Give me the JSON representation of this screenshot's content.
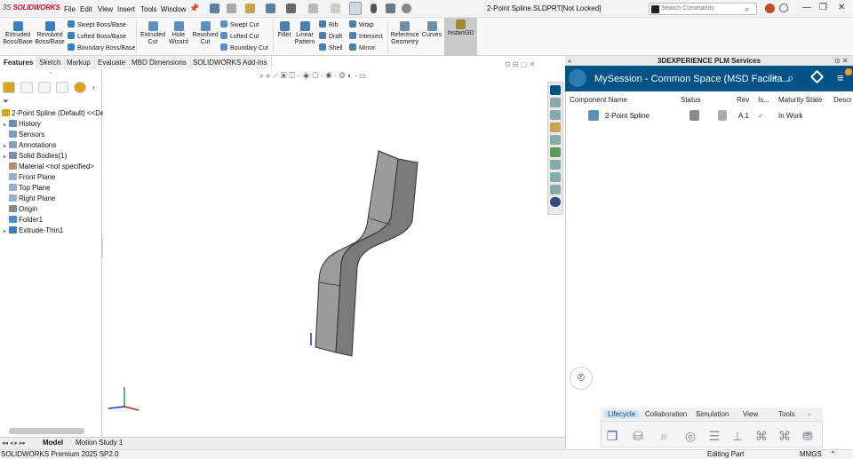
{
  "app": {
    "logo_a": "3S",
    "logo_b": "SOLIDWORKS",
    "title": "2-Point Spline.SLDPRT[Not Locked]",
    "search_placeholder": "Search Commands"
  },
  "menu": [
    "File",
    "Edit",
    "View",
    "Insert",
    "Tools",
    "Window"
  ],
  "ribbon": {
    "big": [
      {
        "l1": "Extruded",
        "l2": "Boss/Base",
        "c": "#3a7fc1"
      },
      {
        "l1": "Revolved",
        "l2": "Boss/Base",
        "c": "#3a7fc1"
      }
    ],
    "small1": [
      "Swept Boss/Base",
      "Lofted Boss/Base",
      "Boundary Boss/Base"
    ],
    "big2": [
      {
        "l1": "Extruded",
        "l2": "Cut",
        "c": "#5c8fbf"
      },
      {
        "l1": "Hole",
        "l2": "Wizard",
        "c": "#5c8fbf"
      },
      {
        "l1": "Revolved",
        "l2": "Cut",
        "c": "#5c8fbf"
      }
    ],
    "small2": [
      "Swept Cut",
      "Lofted Cut",
      "Boundary Cut"
    ],
    "fillet": "Fillet",
    "linear_l1": "Linear",
    "linear_l2": "Pattern",
    "small3": [
      "Rib",
      "Draft",
      "Shell"
    ],
    "small4": [
      "Wrap",
      "Intersect",
      "Mirror"
    ],
    "refgeo_l1": "Reference",
    "refgeo_l2": "Geometry",
    "curves": "Curves",
    "instant3d": "Instant3D"
  },
  "tabs": [
    "Features",
    "Sketch",
    "Markup",
    "Evaluate",
    "MBD Dimensions",
    "SOLIDWORKS Add-Ins"
  ],
  "tree": [
    {
      "label": "2-Point Spline (Default) <<De",
      "c": "#d9a520",
      "exp": ""
    },
    {
      "label": "History",
      "c": "#6b8fb5",
      "exp": "▸"
    },
    {
      "label": "Sensors",
      "c": "#7fa0c0",
      "exp": ""
    },
    {
      "label": "Annotations",
      "c": "#8aa0b0",
      "exp": "▸"
    },
    {
      "label": "Solid Bodies(1)",
      "c": "#7b8fa8",
      "exp": "▸"
    },
    {
      "label": "Material <not specified>",
      "c": "#a7926a",
      "exp": ""
    },
    {
      "label": "Front Plane",
      "c": "#9bb0c7",
      "exp": ""
    },
    {
      "label": "Top Plane",
      "c": "#9bb0c7",
      "exp": ""
    },
    {
      "label": "Right Plane",
      "c": "#9bb0c7",
      "exp": ""
    },
    {
      "label": "Origin",
      "c": "#888",
      "exp": ""
    },
    {
      "label": "Folder1",
      "c": "#4a8fd0",
      "exp": ""
    },
    {
      "label": "Extrude-Thin1",
      "c": "#3a7fc1",
      "exp": "▸"
    }
  ],
  "bottom_tabs": [
    "Model",
    "Motion Study 1"
  ],
  "status": {
    "left": "SOLIDWORKS Premium 2025 SP2.0",
    "mid": "Editing Part",
    "units": "MMGS"
  },
  "plm": {
    "header": "3DEXPERIENCE PLM Services",
    "session": "MySession - Common Space (MSD Facilita...",
    "columns": [
      "Component Name",
      "Status",
      "Rev",
      "Is...",
      "Maturity State",
      "Descr"
    ],
    "row": {
      "name": "2-Point Spline",
      "rev": "A.1",
      "check": "✓",
      "state": "In Work"
    },
    "tabs": [
      "Lifecycle",
      "Collaboration",
      "Simulation",
      "View",
      "Tools"
    ]
  },
  "colors": {
    "plm_bar": "#005386",
    "accent": "#3a7fc1"
  }
}
